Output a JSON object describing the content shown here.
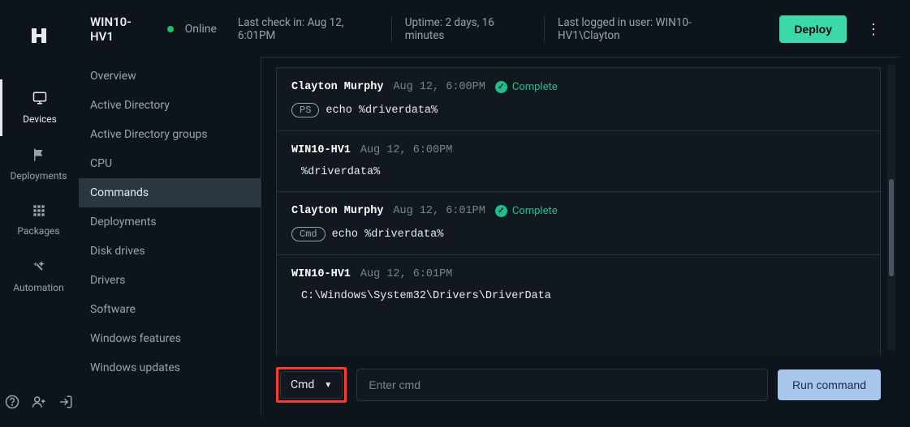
{
  "rail": {
    "items": [
      {
        "label": "Devices"
      },
      {
        "label": "Deployments"
      },
      {
        "label": "Packages"
      },
      {
        "label": "Automation"
      }
    ]
  },
  "header": {
    "device_name": "WIN10-HV1",
    "status": "Online",
    "last_checkin_label": "Last check in:",
    "last_checkin_value": "Aug 12, 6:01PM",
    "uptime_label": "Uptime:",
    "uptime_value": "2 days, 16 minutes",
    "last_user_label": "Last logged in user:",
    "last_user_value": "WIN10-HV1\\Clayton",
    "deploy_label": "Deploy"
  },
  "sidebar": {
    "items": [
      {
        "label": "Overview"
      },
      {
        "label": "Active Directory"
      },
      {
        "label": "Active Directory groups"
      },
      {
        "label": "CPU"
      },
      {
        "label": "Commands"
      },
      {
        "label": "Deployments"
      },
      {
        "label": "Disk drives"
      },
      {
        "label": "Drivers"
      },
      {
        "label": "Software"
      },
      {
        "label": "Windows features"
      },
      {
        "label": "Windows updates"
      }
    ],
    "selected_index": 4
  },
  "log": [
    {
      "type": "cmd",
      "author": "Clayton Murphy",
      "time": "Aug 12, 6:00PM",
      "status": "Complete",
      "shell": "PS",
      "command": "echo %driverdata%"
    },
    {
      "type": "output",
      "author": "WIN10-HV1",
      "time": "Aug 12, 6:00PM",
      "text": "%driverdata%"
    },
    {
      "type": "cmd",
      "author": "Clayton Murphy",
      "time": "Aug 12, 6:01PM",
      "status": "Complete",
      "shell": "Cmd",
      "command": "echo %driverdata%"
    },
    {
      "type": "output",
      "author": "WIN10-HV1",
      "time": "Aug 12, 6:01PM",
      "text": "C:\\Windows\\System32\\Drivers\\DriverData"
    }
  ],
  "input": {
    "shell": "Cmd",
    "placeholder": "Enter cmd",
    "run_label": "Run command"
  }
}
